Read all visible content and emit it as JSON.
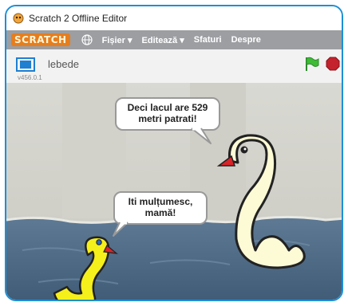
{
  "window": {
    "title": "Scratch 2 Offline Editor"
  },
  "menu": {
    "logo_main": "SCRATC",
    "logo_end": "H",
    "items": [
      "Fișier ▾",
      "Editează ▾",
      "Sfaturi",
      "Despre"
    ]
  },
  "stage_header": {
    "project_name": "lebede",
    "version": "v456.0.1"
  },
  "speech": {
    "big_swan_line1": "Deci lacul are 529",
    "big_swan_line2": "metri patrati!",
    "small_swan_line1": "Iti mulțumesc,",
    "small_swan_line2": "mamă!"
  },
  "colors": {
    "menubar": "#9c9ea2",
    "border": "#1e8fd6",
    "water": "#4d6a84",
    "big_swan": "#fdfbd6",
    "small_swan": "#f5ef1b",
    "beak": "#d9242a"
  }
}
